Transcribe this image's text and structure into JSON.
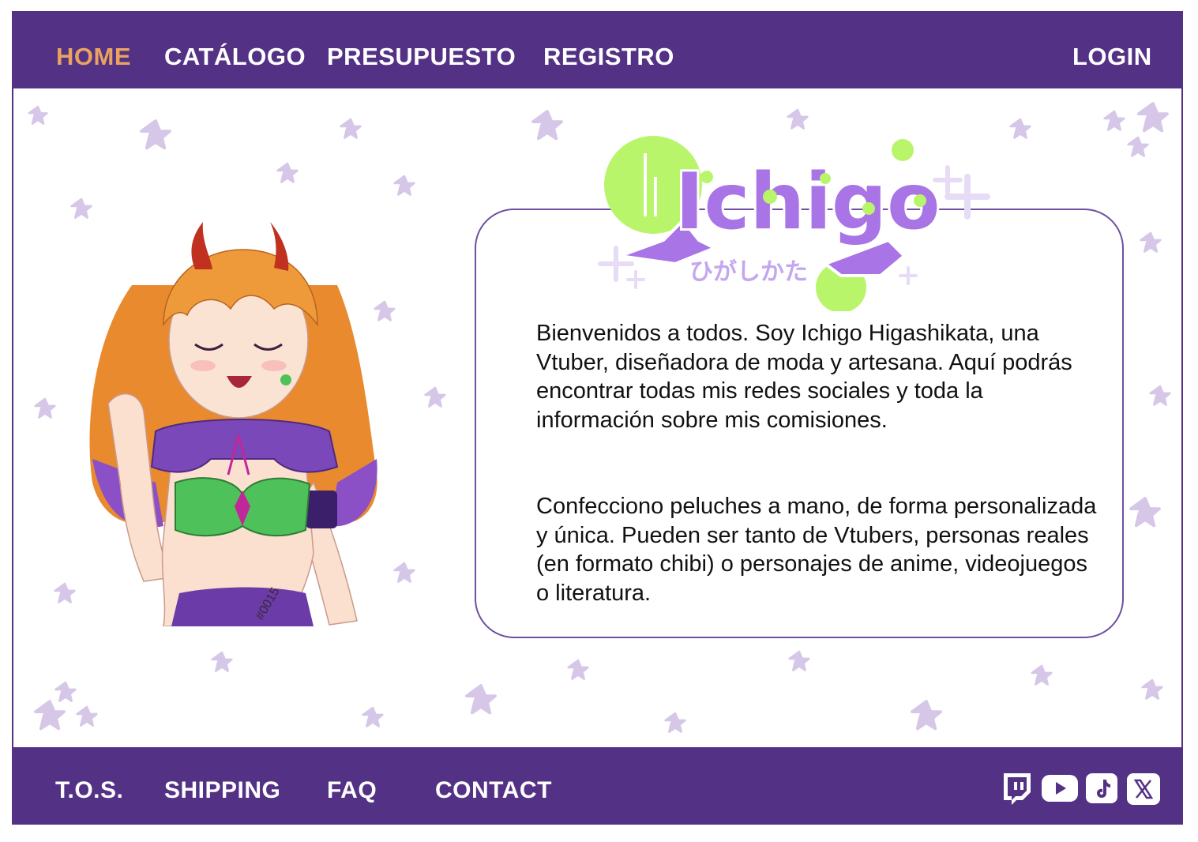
{
  "nav": {
    "items": [
      {
        "label": "HOME",
        "active": true
      },
      {
        "label": "CATÁLOGO",
        "active": false
      },
      {
        "label": "PRESUPUESTO",
        "active": false
      },
      {
        "label": "REGISTRO",
        "active": false
      }
    ],
    "login_label": "LOGIN"
  },
  "logo": {
    "text": "Ichigo",
    "subtitle": "ひがしかた"
  },
  "intro": {
    "paragraph_1": "Bienvenidos a todos. Soy Ichigo Higashikata, una Vtuber, diseñadora de moda y artesana. Aquí podrás encontrar todas mis redes sociales y toda la información sobre mis comisiones.",
    "paragraph_2": "Confecciono peluches a mano, de forma personalizada y única. Pueden ser tanto de Vtubers, personas reales (en formato chibi) o personajes de anime, videojuegos o literatura."
  },
  "avatar": {
    "tattoo_text": "#0015"
  },
  "footer": {
    "links": [
      {
        "label": "T.O.S."
      },
      {
        "label": "SHIPPING"
      },
      {
        "label": "FAQ"
      },
      {
        "label": "CONTACT"
      }
    ],
    "social_icons": [
      "twitch-icon",
      "youtube-icon",
      "tiktok-icon",
      "x-icon"
    ]
  },
  "colors": {
    "brand_purple": "#533185",
    "nav_active": "#e9a35f",
    "star": "#d6c7e8",
    "box_border": "#6f4fa0",
    "logo_lime": "#b9f56a",
    "logo_violet": "#a874e6"
  }
}
